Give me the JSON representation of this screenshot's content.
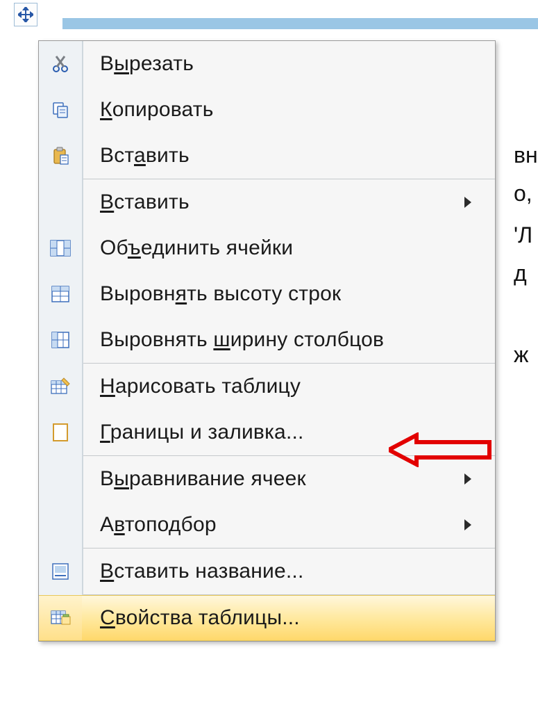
{
  "bg_fragments": [
    "вн",
    "о,",
    "'Л",
    "д",
    "ж"
  ],
  "menu": {
    "cut": {
      "pre": "В",
      "mn": "ы",
      "post": "резать"
    },
    "copy": {
      "pre": "",
      "mn": "К",
      "post": "опировать"
    },
    "paste": {
      "pre": "Вст",
      "mn": "а",
      "post": "вить"
    },
    "insert": {
      "pre": "",
      "mn": "В",
      "post": "ставить"
    },
    "merge": {
      "pre": "Об",
      "mn": "ъ",
      "post": "единить ячейки"
    },
    "row_h": {
      "pre": "Выровн",
      "mn": "я",
      "post": "ть высоту строк"
    },
    "col_w": {
      "pre": "Выровнять ",
      "mn": "ш",
      "post": "ирину столбцов"
    },
    "draw": {
      "pre": "",
      "mn": "Н",
      "post": "арисовать таблицу"
    },
    "borders": {
      "pre": "",
      "mn": "Г",
      "post": "раницы и заливка..."
    },
    "align": {
      "pre": "В",
      "mn": "ы",
      "post": "равнивание ячеек"
    },
    "autofit": {
      "pre": "А",
      "mn": "в",
      "post": "топодбор"
    },
    "caption": {
      "pre": "",
      "mn": "В",
      "post": "ставить название..."
    },
    "props": {
      "pre": "",
      "mn": "С",
      "post": "войства таблицы..."
    }
  }
}
